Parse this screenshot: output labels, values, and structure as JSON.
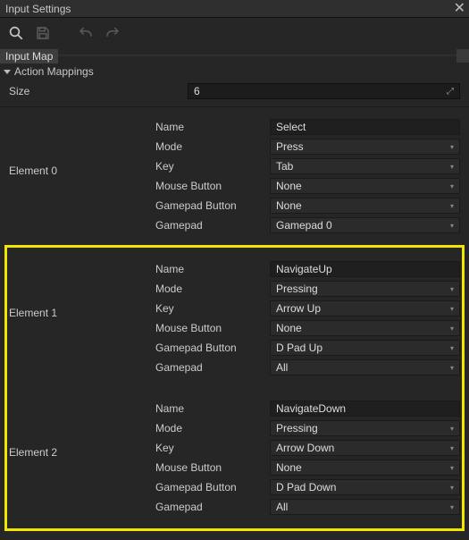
{
  "window": {
    "title": "Input Settings",
    "close": "✕"
  },
  "path": {
    "segment": "Input Map"
  },
  "section": {
    "heading": "Action Mappings"
  },
  "sizeRow": {
    "label": "Size",
    "value": "6"
  },
  "fields": {
    "name": "Name",
    "mode": "Mode",
    "key": "Key",
    "mouse": "Mouse Button",
    "gbtn": "Gamepad Button",
    "gpad": "Gamepad"
  },
  "elements": [
    {
      "label": "Element 0",
      "name": "Select",
      "mode": "Press",
      "key": "Tab",
      "mouse": "None",
      "gbtn": "None",
      "gpad": "Gamepad 0"
    },
    {
      "label": "Element 1",
      "name": "NavigateUp",
      "mode": "Pressing",
      "key": "Arrow Up",
      "mouse": "None",
      "gbtn": "D Pad Up",
      "gpad": "All"
    },
    {
      "label": "Element 2",
      "name": "NavigateDown",
      "mode": "Pressing",
      "key": "Arrow Down",
      "mouse": "None",
      "gbtn": "D Pad Down",
      "gpad": "All"
    }
  ]
}
